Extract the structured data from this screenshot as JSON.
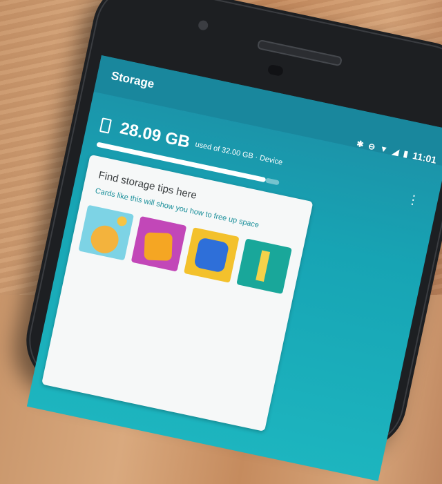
{
  "app": {
    "title": "Storage"
  },
  "status_bar": {
    "time": "11:01",
    "icons": [
      "bluetooth-icon",
      "do-not-disturb-icon",
      "wifi-icon",
      "signal-icon",
      "battery-icon"
    ]
  },
  "storage": {
    "used": "28.09 GB",
    "detail": "used of 32.00 GB · Device",
    "used_fraction": 0.878
  },
  "card": {
    "title": "Find storage tips here",
    "subtitle": "Cards like this will show you how to free up space"
  },
  "colors": {
    "appbar": "#19879d",
    "screen": "#17a4b4",
    "accent": "#1a8f9a"
  }
}
